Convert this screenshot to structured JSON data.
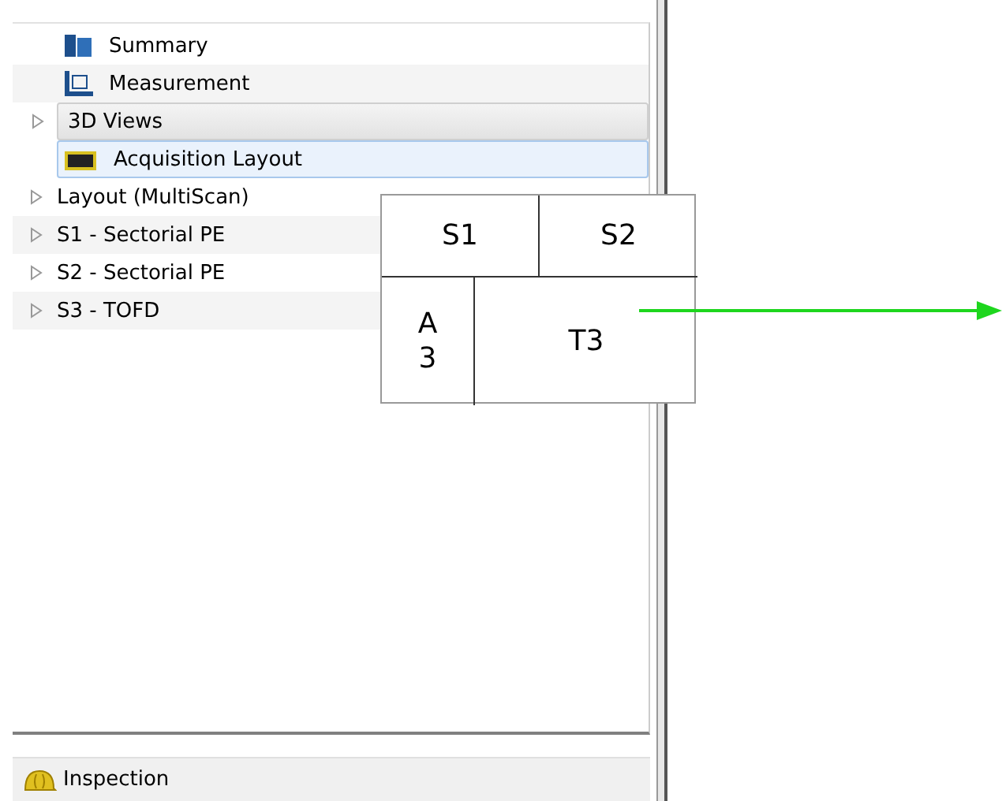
{
  "tree": {
    "items": [
      {
        "label": "Summary",
        "kind": "book",
        "expandable": false,
        "selected": false,
        "hovered": false
      },
      {
        "label": "Measurement",
        "kind": "ruler",
        "expandable": false,
        "selected": false,
        "hovered": false
      },
      {
        "label": "3D Views",
        "kind": "plain",
        "expandable": true,
        "selected": false,
        "hovered": true
      },
      {
        "label": "Acquisition Layout",
        "kind": "camera",
        "expandable": false,
        "selected": true,
        "hovered": false
      },
      {
        "label": "Layout (MultiScan)",
        "kind": "plain",
        "expandable": true,
        "selected": false,
        "hovered": false
      },
      {
        "label": "S1 - Sectorial PE",
        "kind": "plain",
        "expandable": true,
        "selected": false,
        "hovered": false
      },
      {
        "label": "S2 - Sectorial PE",
        "kind": "plain",
        "expandable": true,
        "selected": false,
        "hovered": false
      },
      {
        "label": "S3 - TOFD",
        "kind": "plain",
        "expandable": true,
        "selected": false,
        "hovered": false
      }
    ]
  },
  "status_bar": {
    "label": "Inspection"
  },
  "layout_diagram": {
    "cells": [
      "S1",
      "S2",
      "A3",
      "T3"
    ]
  }
}
